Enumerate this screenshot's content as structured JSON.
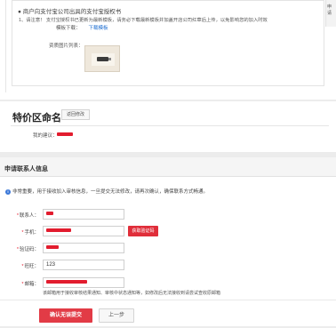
{
  "notice": {
    "title": "商户向支付宝公司出具的支付宝授权书",
    "tip": "1、请注意！ 支付宝授权书已更新为最新模板，请务必下载最新模板并加盖开店公司红章后上传，以免影响您的加入时效",
    "template_label": "模板下载：",
    "template_link": "下载模板",
    "image_label": "资质图片列表："
  },
  "side_tab": "申请",
  "special_section": {
    "title": "特价区命名",
    "edit_button": "返回修改",
    "suggestion_label": "我的建议："
  },
  "contact": {
    "header": "申请联系人信息",
    "info": "非常重要，用于接收加入审核信息，一旦提交无法修改，请再次确认，确保联系方式畅通。",
    "fields": [
      {
        "label": "联系人：",
        "required": true,
        "value": ""
      },
      {
        "label": "手机：",
        "required": true,
        "value": ""
      },
      {
        "label": "验证码：",
        "required": true,
        "value": ""
      },
      {
        "label": "旺旺：",
        "required": true,
        "value": "123"
      },
      {
        "label": "邮箱：",
        "required": true,
        "value": ""
      }
    ],
    "code_button": "获取验证码",
    "email_hint": "该邮箱用于接收审核结果通知、审核中状态通知等，如修改后无法接收到请尝试查收原邮箱"
  },
  "actions": {
    "submit": "确认无误提交",
    "prev": "上一步"
  },
  "colors": {
    "accent": "#e23b46",
    "link": "#1f6fd1",
    "info": "#3b78d8"
  }
}
